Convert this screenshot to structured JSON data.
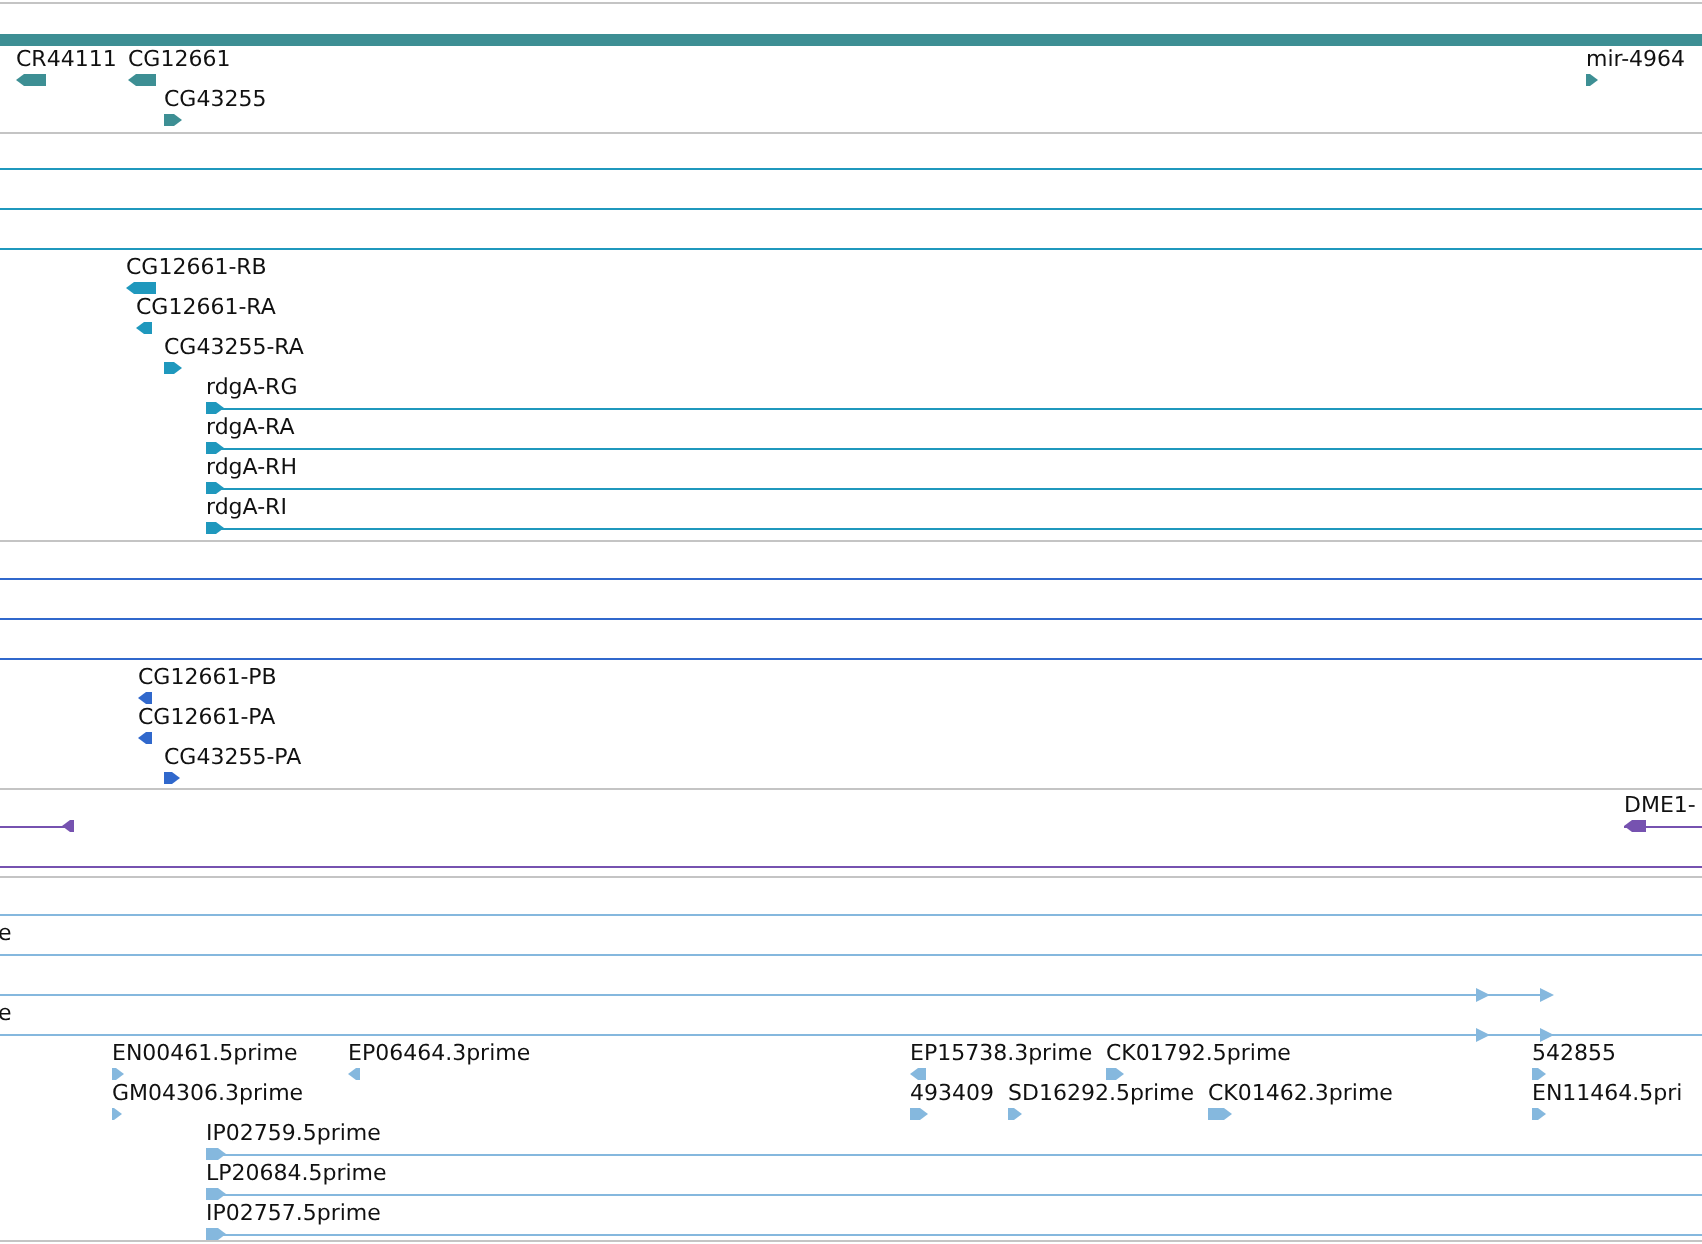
{
  "tracks": [
    {
      "kind": "gene",
      "color": "#3d8f94",
      "rows": [
        {
          "features": [
            {
              "label": "CR44111",
              "reverse": true
            },
            {
              "label": "CG12661",
              "reverse": true
            },
            {
              "label": "mir-4964",
              "reverse": false
            }
          ]
        },
        {
          "features": [
            {
              "label": "CG43255",
              "reverse": false
            }
          ]
        }
      ]
    },
    {
      "kind": "transcript",
      "color": "#1f98bd",
      "rows": [
        {
          "features": []
        },
        {
          "features": []
        },
        {
          "features": []
        },
        {
          "features": [
            {
              "label": "CG12661-RB",
              "reverse": true
            }
          ]
        },
        {
          "features": [
            {
              "label": "CG12661-RA",
              "reverse": true
            }
          ]
        },
        {
          "features": [
            {
              "label": "CG43255-RA",
              "reverse": false
            }
          ]
        },
        {
          "features": [
            {
              "label": "rdgA-RG",
              "reverse": false
            }
          ]
        },
        {
          "features": [
            {
              "label": "rdgA-RA",
              "reverse": false
            }
          ]
        },
        {
          "features": [
            {
              "label": "rdgA-RH",
              "reverse": false
            }
          ]
        },
        {
          "features": [
            {
              "label": "rdgA-RI",
              "reverse": false
            }
          ]
        }
      ]
    },
    {
      "kind": "transcript",
      "color": "#3068cc",
      "rows": [
        {
          "features": []
        },
        {
          "features": []
        },
        {
          "features": []
        },
        {
          "features": [
            {
              "label": "CG12661-PB",
              "reverse": true
            }
          ]
        },
        {
          "features": [
            {
              "label": "CG12661-PA",
              "reverse": true
            }
          ]
        },
        {
          "features": [
            {
              "label": "CG43255-PA",
              "reverse": false
            }
          ]
        }
      ]
    },
    {
      "kind": "transcript",
      "color": "#7652b0",
      "rows": [
        {
          "features": [
            {
              "reverse": true
            },
            {
              "label": "DME1-",
              "reverse": true
            }
          ]
        },
        {
          "features": []
        }
      ]
    },
    {
      "kind": "transcript",
      "color": "#85b8de",
      "rows": [
        {
          "features": []
        },
        {
          "features": [
            {
              "label": "e"
            }
          ]
        },
        {
          "features": []
        },
        {
          "features": [
            {
              "label": "e"
            }
          ]
        },
        {
          "features": [
            {
              "label": "EN00461.5prime",
              "reverse": false
            },
            {
              "label": "EP06464.3prime",
              "reverse": true
            },
            {
              "label": "EP15738.3prime",
              "reverse": true
            },
            {
              "label": "CK01792.5prime",
              "reverse": false
            },
            {
              "label": "542855",
              "reverse": false
            }
          ]
        },
        {
          "features": [
            {
              "label": "GM04306.3prime",
              "reverse": false
            },
            {
              "label": "493409",
              "reverse": false
            },
            {
              "label": "SD16292.5prime",
              "reverse": false
            },
            {
              "label": "CK01462.3prime",
              "reverse": false
            },
            {
              "label": "EN11464.5pri",
              "reverse": false
            }
          ]
        },
        {
          "features": [
            {
              "label": "IP02759.5prime",
              "reverse": false
            }
          ]
        },
        {
          "features": [
            {
              "label": "LP20684.5prime",
              "reverse": false
            }
          ]
        },
        {
          "features": [
            {
              "label": "IP02757.5prime",
              "reverse": false
            }
          ]
        }
      ]
    }
  ]
}
